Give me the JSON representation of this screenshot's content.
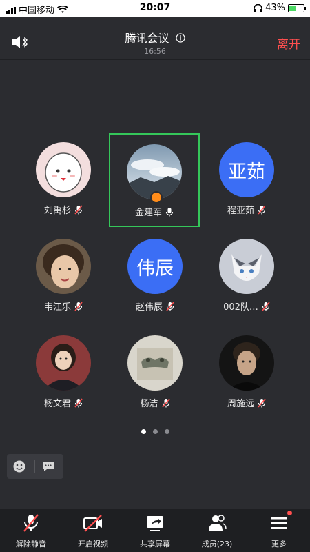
{
  "status": {
    "carrier": "中国移动",
    "time": "20:07",
    "battery": "43%",
    "battery_level": 0.43
  },
  "header": {
    "title": "腾讯会议",
    "elapsed": "16:56",
    "leave_label": "离开"
  },
  "participants": [
    {
      "name": "刘禹杉",
      "avatar": "photo",
      "mic": "muted"
    },
    {
      "name": "金建军",
      "avatar": "photo",
      "mic": "on",
      "active": true,
      "host": true
    },
    {
      "name": "程亚茹",
      "avatar": "text",
      "avatar_text": "亚茹",
      "mic": "muted"
    },
    {
      "name": "韦江乐",
      "avatar": "photo",
      "mic": "muted"
    },
    {
      "name": "赵伟辰",
      "avatar": "text",
      "avatar_text": "伟辰",
      "mic": "muted"
    },
    {
      "name": "002队…",
      "avatar": "photo",
      "mic": "muted"
    },
    {
      "name": "杨文君",
      "avatar": "photo",
      "mic": "muted"
    },
    {
      "name": "杨洁",
      "avatar": "photo",
      "mic": "muted"
    },
    {
      "name": "周施远",
      "avatar": "photo",
      "mic": "muted"
    }
  ],
  "pager": {
    "pages": 3,
    "current": 1
  },
  "toolbar": {
    "unmute": "解除静音",
    "video": "开启视频",
    "share": "共享屏幕",
    "members": "成员(23)",
    "more": "更多"
  },
  "colors": {
    "accent": "#3b6ef5",
    "active_border": "#35c75a",
    "leave": "#ff4f4f",
    "muted": "#ff4f4f"
  }
}
